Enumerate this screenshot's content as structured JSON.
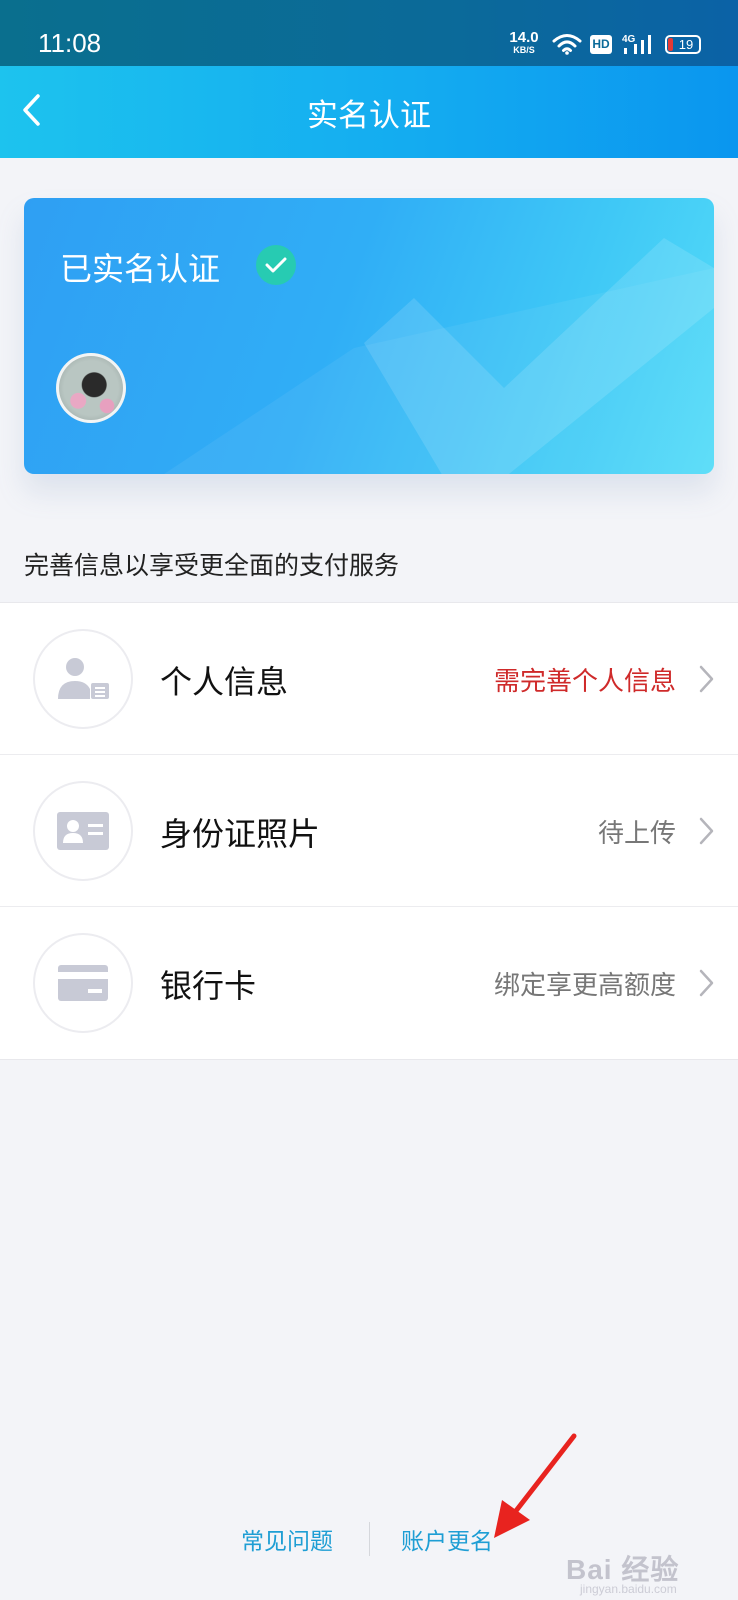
{
  "status_bar": {
    "time": "11:08",
    "net_speed_value": "14.0",
    "net_speed_unit": "KB/S",
    "hd": "HD",
    "network": "4G",
    "battery": "19"
  },
  "nav": {
    "title": "实名认证"
  },
  "card": {
    "verified_label": "已实名认证"
  },
  "section_title": "完善信息以享受更全面的支付服务",
  "items": [
    {
      "label": "个人信息",
      "status": "需完善个人信息",
      "icon": "person-id-icon",
      "status_color": "#cf2a2a"
    },
    {
      "label": "身份证照片",
      "status": "待上传",
      "icon": "id-card-icon"
    },
    {
      "label": "银行卡",
      "status": "绑定享更高额度",
      "icon": "bank-card-icon"
    }
  ],
  "footer": {
    "faq": "常见问题",
    "rename": "账户更名"
  },
  "watermark": {
    "main": "Bai 经验",
    "sub": "jingyan.baidu.com"
  },
  "colors": {
    "accent": "#14acf0",
    "link": "#1e9ed4",
    "warning": "#cf2a2a",
    "check": "#27cbb2"
  }
}
